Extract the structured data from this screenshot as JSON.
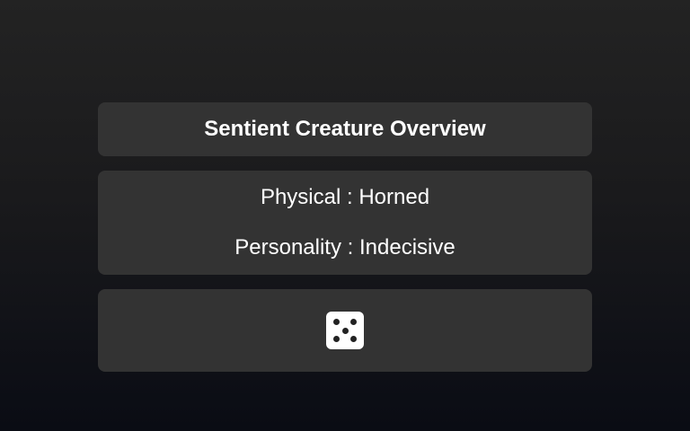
{
  "header": {
    "title": "Sentient Creature Overview"
  },
  "traits": [
    {
      "label": "Physical",
      "separator": " : ",
      "value": "Horned"
    },
    {
      "label": "Personality",
      "separator": " : ",
      "value": "Indecisive"
    }
  ],
  "randomize": {
    "icon": "dice-five-icon",
    "face_value": 5
  },
  "colors": {
    "panel": "#333333",
    "text": "#ffffff",
    "dice": "#ffffff",
    "pip": "#222222"
  }
}
